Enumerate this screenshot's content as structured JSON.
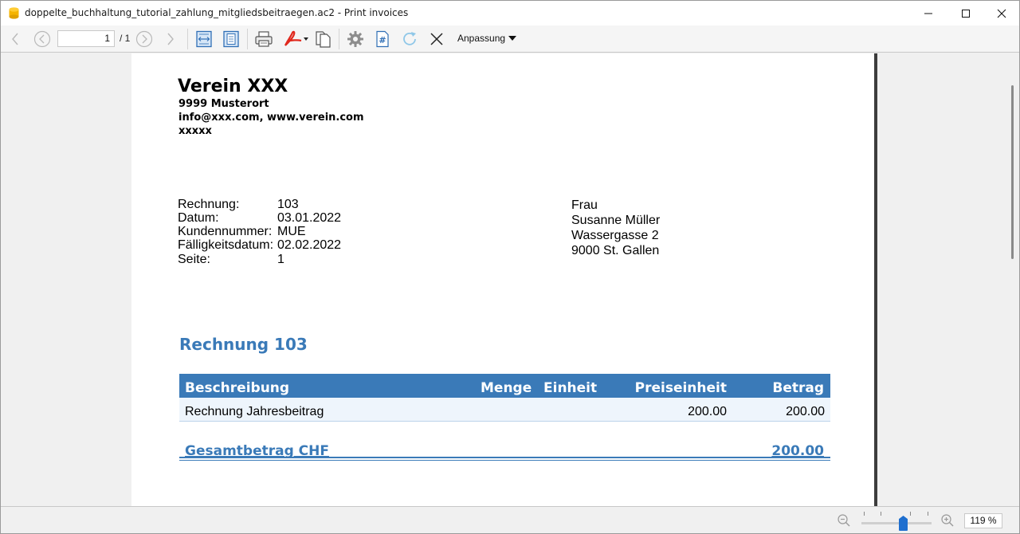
{
  "window": {
    "title": "doppelte_buchhaltung_tutorial_zahlung_mitgliedsbeitraegen.ac2 - Print invoices"
  },
  "toolbar": {
    "page_number": "1",
    "page_total": "/ 1",
    "zoom_mode": "Anpassung"
  },
  "invoice": {
    "org": {
      "name": "Verein XXX",
      "city": "9999 Musterort",
      "contact": "info@xxx.com, www.verein.com",
      "extra": "xxxxx"
    },
    "info": [
      {
        "label": "Rechnung:",
        "value": "103"
      },
      {
        "label": "Datum:",
        "value": "03.01.2022"
      },
      {
        "label": "Kundennummer:",
        "value": "MUE"
      },
      {
        "label": "Fälligkeitsdatum:",
        "value": "02.02.2022"
      },
      {
        "label": "Seite:",
        "value": "1"
      }
    ],
    "address": [
      "Frau",
      "Susanne Müller",
      "Wassergasse 2",
      "9000 St. Gallen"
    ],
    "title": "Rechnung 103",
    "table": {
      "headers": {
        "description": "Beschreibung",
        "quantity": "Menge",
        "unit": "Einheit",
        "unit_price": "Preiseinheit",
        "amount": "Betrag"
      },
      "rows": [
        {
          "description": "Rechnung Jahresbeitrag",
          "quantity": "",
          "unit": "",
          "unit_price": "200.00",
          "amount": "200.00"
        }
      ]
    },
    "total": {
      "label": "Gesamtbetrag CHF",
      "value": "200.00"
    }
  },
  "statusbar": {
    "zoom_value": "119 %",
    "zoom_level": 0.6
  },
  "colors": {
    "accent": "#3a7ab8",
    "row_bg": "#eef5fc",
    "zoom_thumb": "#1f6fcf"
  }
}
